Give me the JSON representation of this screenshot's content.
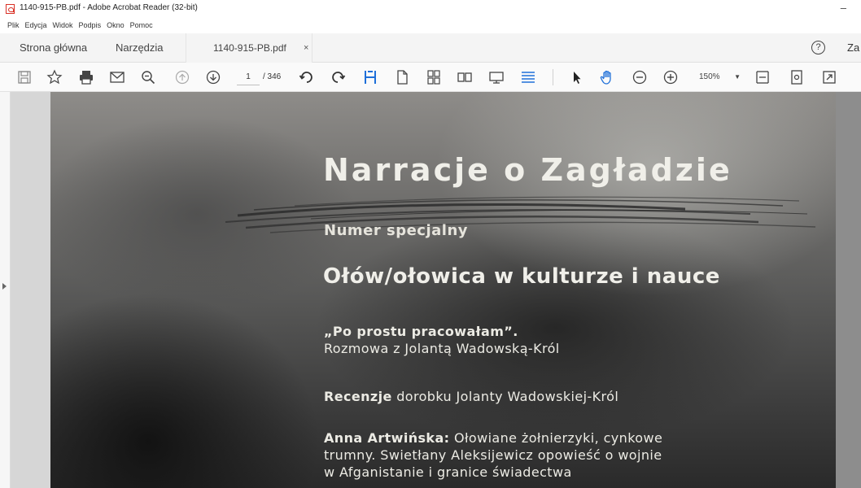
{
  "window": {
    "title": "1140-915-PB.pdf - Adobe Acrobat Reader (32-bit)",
    "minimize_label": "–"
  },
  "menu": [
    "Plik",
    "Edycja",
    "Widok",
    "Podpis",
    "Okno",
    "Pomoc"
  ],
  "tabs": {
    "home": "Strona główna",
    "tools": "Narzędzia",
    "document": "1140-915-PB.pdf",
    "close": "×"
  },
  "header": {
    "help": "?",
    "sign_in": "Za"
  },
  "toolbar": {
    "current_page": "1",
    "total_pages": "/ 346",
    "zoom": "150%",
    "zoom_arrow": "▼",
    "icons": [
      "save-icon",
      "bookmark-star-icon",
      "print-icon",
      "email-icon",
      "zoom-search-icon",
      "prev-page-icon",
      "next-page-icon",
      "rotate-ccw-icon",
      "rotate-cw-icon",
      "fit-page-icon",
      "single-page-icon",
      "scroll-pages-icon",
      "two-page-icon",
      "presentation-icon",
      "reading-mode-icon",
      "select-cursor-icon",
      "hand-tool-icon",
      "zoom-out-icon",
      "zoom-in-icon",
      "fit-width-icon",
      "page-view-icon",
      "fullscreen-icon"
    ]
  },
  "cover": {
    "title": "Narracje o Zagładzie",
    "subtitle": "Numer specjalny",
    "theme": "Ołów/ołowica w kulturze i nauce",
    "items": [
      {
        "bold": "„Po prostu pracowałam”.",
        "lines": [
          "Rozmowa z Jolantą Wadowską-Król"
        ]
      },
      {
        "bold": "Recenzje",
        "rest": " dorobku Jolanty Wadowskiej-Król"
      },
      {
        "bold": "Anna Artwińska:",
        "rest": " Ołowiane żołnierzyki, cynkowe",
        "lines": [
          "trumny. Swietłany Aleksijewicz opowieść o wojnie",
          "w Afganistanie i granice świadectwa"
        ]
      }
    ]
  }
}
